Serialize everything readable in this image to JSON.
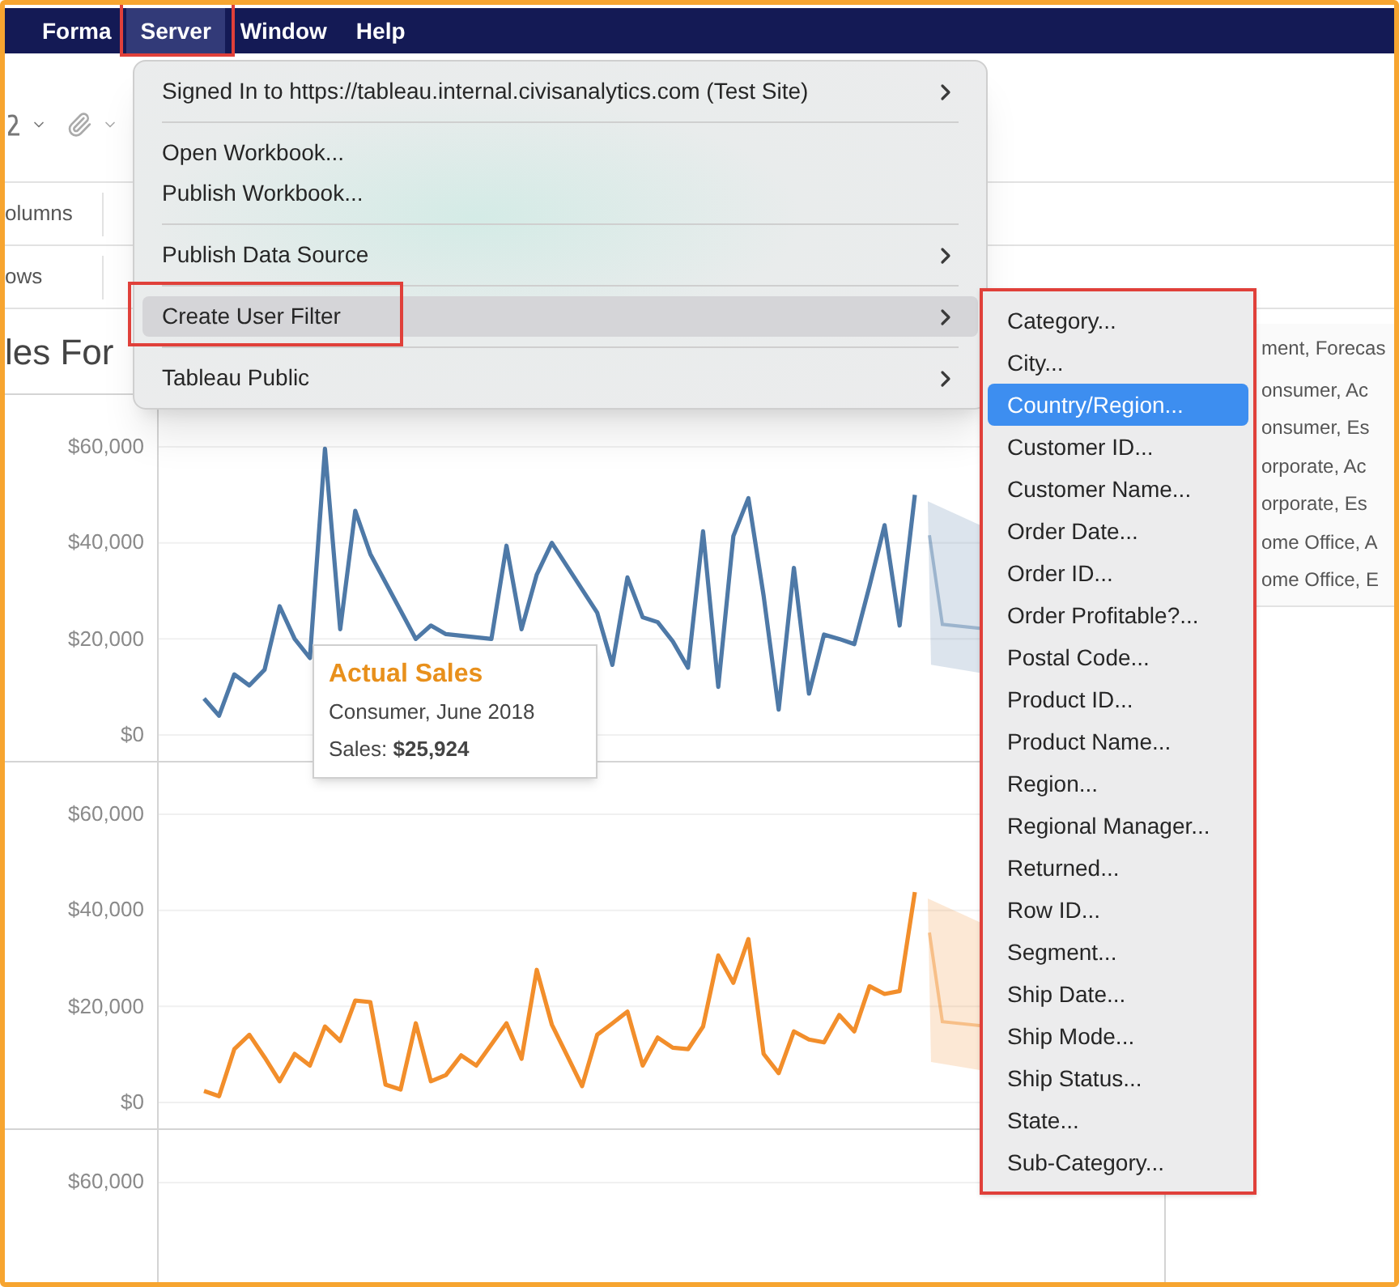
{
  "menu_bar": {
    "items": [
      {
        "label": "Forma",
        "selected": false,
        "outlined": false
      },
      {
        "label": "Server",
        "selected": true,
        "outlined": true
      },
      {
        "label": "Window",
        "selected": false,
        "outlined": false
      },
      {
        "label": "Help",
        "selected": false,
        "outlined": false
      }
    ]
  },
  "shelves": [
    {
      "label": "olumns"
    },
    {
      "label": "ows"
    }
  ],
  "sheet_title": "les For",
  "panes": [
    {
      "chart_data": {
        "type": "line",
        "yticks": [
          {
            "value": 0,
            "label": "$0"
          },
          {
            "value": 20000,
            "label": "$20,000"
          },
          {
            "value": 40000,
            "label": "$40,000"
          },
          {
            "value": 60000,
            "label": "$60,000"
          }
        ],
        "ylim": [
          0,
          60000
        ],
        "series": [
          {
            "color": "#4e79a7",
            "values": [
              7600,
              4000,
              12600,
              10300,
              13600,
              26800,
              20000,
              16000,
              59600,
              22000,
              46700,
              37700,
              null,
              null,
              20000,
              22800,
              21000,
              null,
              null,
              20000,
              39400,
              22000,
              33400,
              40000,
              null,
              null,
              25500,
              14600,
              32800,
              24500,
              23500,
              19500,
              14000,
              42400,
              10000,
              41400,
              49300,
              29000,
              5300,
              34800,
              8600,
              20900,
              20000,
              18900,
              31000,
              43700,
              22800,
              50000
            ]
          }
        ]
      }
    },
    {
      "chart_data": {
        "type": "line",
        "yticks": [
          {
            "value": 0,
            "label": "$0"
          },
          {
            "value": 20000,
            "label": "$20,000"
          },
          {
            "value": 40000,
            "label": "$40,000"
          },
          {
            "value": 60000,
            "label": "$60,000"
          }
        ],
        "ylim": [
          0,
          60000
        ],
        "series": [
          {
            "color": "#f28e2b",
            "values": [
              2400,
              1300,
              11100,
              14100,
              9400,
              4400,
              10100,
              7700,
              15800,
              12800,
              21200,
              20900,
              3700,
              2700,
              16500,
              4400,
              5700,
              9800,
              7700,
              12100,
              16500,
              9100,
              27600,
              16200,
              9800,
              3400,
              14100,
              16500,
              18900,
              7700,
              13500,
              11400,
              11100,
              15800,
              30600,
              24900,
              34000,
              10100,
              6100,
              14800,
              13100,
              12500,
              18200,
              14800,
              24200,
              22600,
              23200,
              43800
            ]
          }
        ]
      }
    },
    {
      "tick_label": "$60,000"
    }
  ],
  "legend": {
    "header": "ment, Forecas",
    "items": [
      {
        "label": "onsumer, Ac"
      },
      {
        "label": "onsumer, Es"
      },
      {
        "label": "orporate, Ac"
      },
      {
        "label": "orporate, Es"
      },
      {
        "label": "ome Office, A"
      },
      {
        "label": "ome Office, E"
      }
    ]
  },
  "tooltip": {
    "title": "Actual Sales",
    "line": "Consumer, June 2018",
    "value": "Sales: **$25,924**"
  },
  "server_menu": {
    "groups": [
      [
        {
          "label": "Signed In to https://tableau.internal.civisanalytics.com (Test Site)",
          "has_submenu": true,
          "selected": false,
          "outlined": false
        }
      ],
      [
        {
          "label": "Open Workbook...",
          "has_submenu": false,
          "selected": false,
          "outlined": false
        },
        {
          "label": "Publish Workbook...",
          "has_submenu": false,
          "selected": false,
          "outlined": false
        }
      ],
      [
        {
          "label": "Publish Data Source",
          "has_submenu": true,
          "selected": false,
          "outlined": false
        }
      ],
      [
        {
          "label": "Create User Filter",
          "has_submenu": true,
          "selected": true,
          "outlined": true
        }
      ],
      [
        {
          "label": "Tableau Public",
          "has_submenu": true,
          "selected": false,
          "outlined": false
        }
      ]
    ]
  },
  "submenu": {
    "outlined": true,
    "items": [
      {
        "label": "Category...",
        "selected": false
      },
      {
        "label": "City...",
        "selected": false
      },
      {
        "label": "Country/Region...",
        "selected": true
      },
      {
        "label": "Customer ID...",
        "selected": false
      },
      {
        "label": "Customer Name...",
        "selected": false
      },
      {
        "label": "Order Date...",
        "selected": false
      },
      {
        "label": "Order ID...",
        "selected": false
      },
      {
        "label": "Order Profitable?...",
        "selected": false
      },
      {
        "label": "Postal Code...",
        "selected": false
      },
      {
        "label": "Product ID...",
        "selected": false
      },
      {
        "label": "Product Name...",
        "selected": false
      },
      {
        "label": "Region...",
        "selected": false
      },
      {
        "label": "Regional Manager...",
        "selected": false
      },
      {
        "label": "Returned...",
        "selected": false
      },
      {
        "label": "Row ID...",
        "selected": false
      },
      {
        "label": "Segment...",
        "selected": false
      },
      {
        "label": "Ship Date...",
        "selected": false
      },
      {
        "label": "Ship Mode...",
        "selected": false
      },
      {
        "label": "Ship Status...",
        "selected": false
      },
      {
        "label": "State...",
        "selected": false
      },
      {
        "label": "Sub-Category...",
        "selected": false
      }
    ]
  }
}
